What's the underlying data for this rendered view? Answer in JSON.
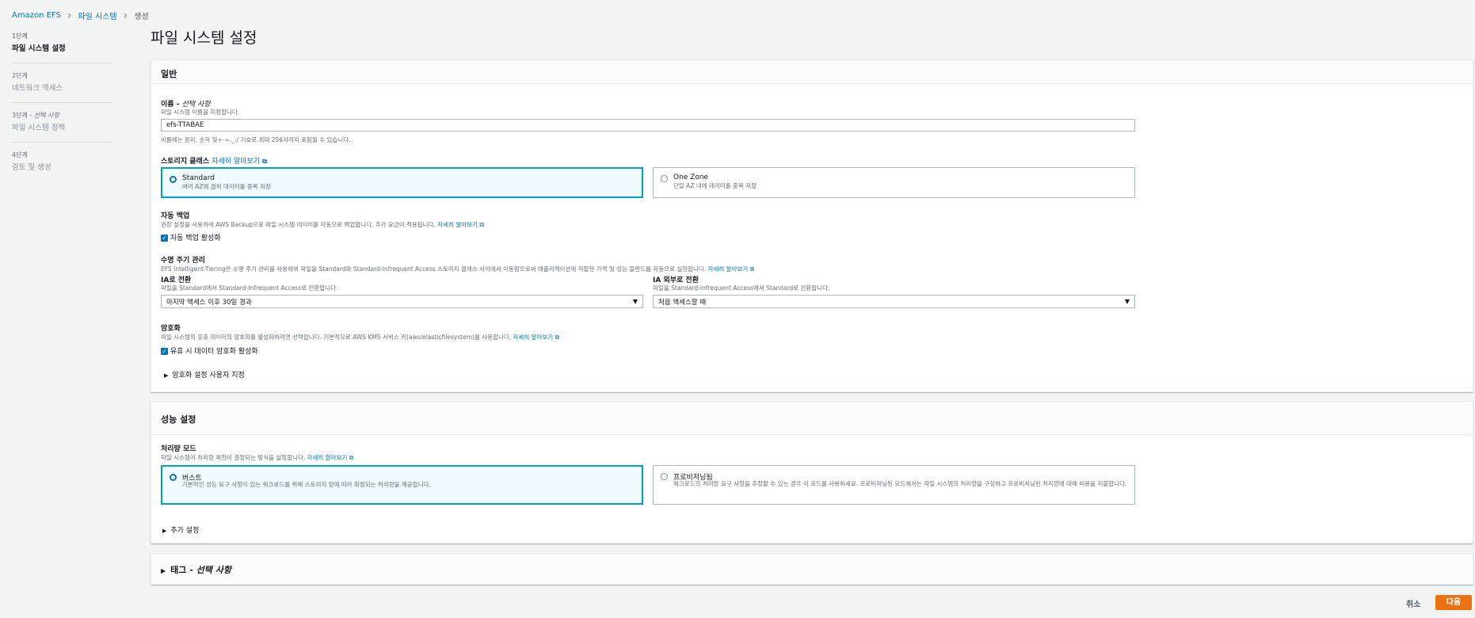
{
  "breadcrumb": {
    "item1": "Amazon EFS",
    "item2": "파일 시스템",
    "item3": "생성"
  },
  "steps": [
    {
      "num": "1단계",
      "name": "파일 시스템 설정"
    },
    {
      "num": "2단계",
      "name": "네트워크 액세스"
    },
    {
      "num": "3단계 - ",
      "num_italic": "선택 사항",
      "name": "파일 시스템 정책"
    },
    {
      "num": "4단계",
      "name": "검토 및 생성"
    }
  ],
  "page_title": "파일 시스템 설정",
  "general": {
    "header": "일반",
    "name": {
      "label": "이름 - ",
      "label_italic": "선택 사항",
      "desc": "파일 시스템 이름을 지정합니다.",
      "value": "efs-TTABAE",
      "hint": "이름에는 문자, 숫자 및+-=._:/ 기호로 최대 256자까지 포함될 수 있습니다."
    },
    "storage_class": {
      "label": "스토리지 클래스",
      "learn_more": "자세히 알아보기",
      "standard_title": "Standard",
      "standard_desc": "여러 AZ에 걸쳐 데이터를 중복 저장",
      "onezone_title": "One Zone",
      "onezone_desc": "단일 AZ 내에 데이터를 중복 저장"
    },
    "backup": {
      "label": "자동 백업",
      "desc": "권장 설정을 사용하여 AWS Backup으로 파일 시스템 데이터를 자동으로 백업합니다. 추가 요금이 적용됩니다.",
      "learn_more": "자세히 알아보기",
      "checkbox": "자동 백업 활성화"
    },
    "lifecycle": {
      "label": "수명 주기 관리",
      "desc": "EFS Intelligent-Tiering은 수명 주기 관리를 사용하여 파일을 Standard와 Standard-Infrequent Access 스토리지 클래스 사이에서 이동함으로써 애플리케이션에 적합한 가격 및 성능 블렌드를 자동으로 실현합니다.",
      "learn_more": "자세히 알아보기",
      "ia_label": "IA로 전환",
      "ia_desc": "파일을 Standard에서 Standard-Infrequent Access로 전환합니다.",
      "ia_value": "마지막 액세스 이후 30일 경과",
      "out_label": "IA 외부로 전환",
      "out_desc": "파일을 Standard-Infrequent Access에서 Standard로 전환합니다.",
      "out_value": "처음 액세스할 때"
    },
    "encryption": {
      "label": "암호화",
      "desc": "파일 시스템의 유휴 데이터의 암호화를 활성화하려면 선택합니다. 기본적으로 AWS KMS 서비스 키(aws/elasticfilesystem)를 사용합니다.",
      "learn_more": "자세히 알아보기",
      "checkbox": "유휴 시 데이터 암호화 활성화",
      "expander": "암호화 설정 사용자 지정"
    }
  },
  "performance": {
    "header": "성능 설정",
    "throughput": {
      "label": "처리량 모드",
      "desc": "파일 시스템이 처리량 제한이 결정되는 방식을 설정합니다.",
      "learn_more": "자세히 알아보기",
      "burst_title": "버스트",
      "burst_desc": "기본적인 성능 요구 사항이 있는 워크로드를 위해 스토리지 양에 따라 확장되는 처리량을 제공합니다.",
      "prov_title": "프로비저닝됨",
      "prov_desc": "워크로드의 처리량 요구 사항을 추정할 수 있는 경우 이 모드를 사용하세요. 프로비저닝된 모드에서는 파일 시스템의 처리량을 구성하고 프로비저닝된 처리량에 대해 비용을 지불합니다."
    },
    "expander": "추가 설정"
  },
  "tags": {
    "label": "태그 - ",
    "label_italic": "선택 사항"
  },
  "footer": {
    "cancel": "취소",
    "next": "다음"
  }
}
